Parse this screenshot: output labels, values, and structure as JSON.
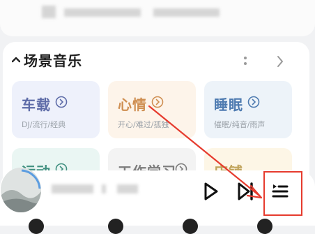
{
  "section": {
    "title": "场景音乐"
  },
  "tiles": [
    {
      "title": "车载",
      "subtitle": "DJ/流行/经典",
      "color": "#5e6ca8",
      "bg": "#eef1fb"
    },
    {
      "title": "心情",
      "subtitle": "开心/难过/孤独",
      "color": "#cf8f52",
      "bg": "#fdf4ea"
    },
    {
      "title": "睡眠",
      "subtitle": "催眠/纯音/雨声",
      "color": "#4d7ab0",
      "bg": "#edf3f9"
    },
    {
      "title": "运动",
      "color": "#3f8f7f",
      "bg": "#eaf6f3"
    },
    {
      "title": "工作学习",
      "color": "#7c7c7c",
      "bg": "#f3f3f3"
    },
    {
      "title": "店铺",
      "color": "#c0a35a",
      "bg": "#fdf6e6"
    }
  ],
  "player": {
    "icons": {
      "play": "play-icon",
      "next": "next-icon",
      "playlist": "playlist-icon"
    }
  },
  "annotation": {
    "color": "#e63b2e"
  }
}
